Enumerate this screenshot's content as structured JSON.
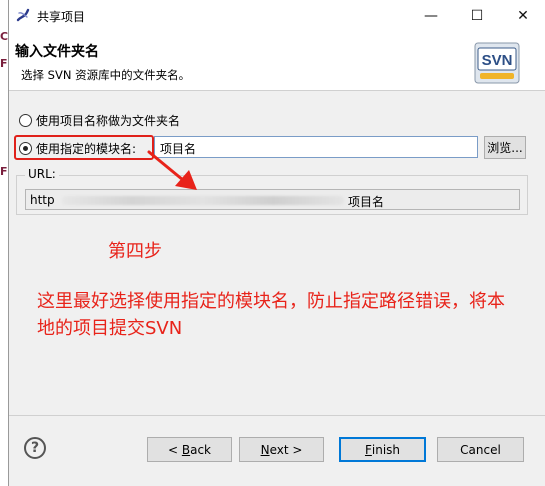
{
  "background_fragments": [
    "C",
    "F",
    "F"
  ],
  "window": {
    "title": "共享项目",
    "min_symbol": "—",
    "max_symbol": "☐",
    "close_symbol": "✕"
  },
  "header": {
    "title": "输入文件夹名",
    "subtitle": "选择 SVN 资源库中的文件夹名。",
    "logo_text": "SVN"
  },
  "options": {
    "use_project_name": "使用项目名称做为文件夹名",
    "use_module_name": "使用指定的模块名:",
    "selected": "use_module_name"
  },
  "module_input": {
    "value": "项目名"
  },
  "browse_button": "浏览...",
  "url_group": {
    "label": "URL:",
    "prefix": "http",
    "suffix": "项目名"
  },
  "annotations": {
    "step": "第四步",
    "note": "这里最好选择使用指定的模块名，防止指定路径错误，将本地的项目提交SVN"
  },
  "footer": {
    "help": "?",
    "back": {
      "prefix": "< ",
      "mnemonic": "B",
      "rest": "ack"
    },
    "next": {
      "mnemonic": "N",
      "rest": "ext >"
    },
    "finish": {
      "mnemonic": "F",
      "rest": "inish"
    },
    "cancel": "Cancel"
  },
  "colors": {
    "annotation_red": "#e8231a",
    "focus_blue": "#0078d7"
  }
}
